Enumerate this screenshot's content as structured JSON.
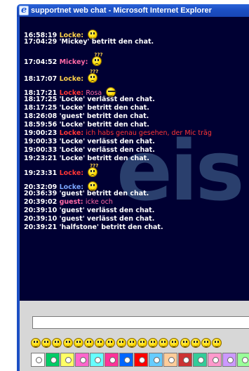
{
  "window": {
    "title": "supportnet web chat - Microsoft Internet Explorer"
  },
  "chat": {
    "watermark": "eis",
    "lines": [
      {
        "time": "16:58:19",
        "nick": "Locke:",
        "text": "",
        "smiley": "happy"
      },
      {
        "time": "17:04:29",
        "nick": "",
        "text": "'Mickey' betritt den chat."
      },
      {
        "time": "17:04:52",
        "nick": "Mickey:",
        "text": "",
        "smiley": "think"
      },
      {
        "time": "18:17:07",
        "nick": "Locke:",
        "text": "",
        "smiley": "think"
      },
      {
        "time": "18:17:21",
        "nick": "Locke:",
        "text": "Rosa",
        "smiley": "cool"
      },
      {
        "time": "18:17:25",
        "nick": "",
        "text": "'Locke' verlässt den chat."
      },
      {
        "time": "18:17:25",
        "nick": "",
        "text": "'Locke' betritt den chat."
      },
      {
        "time": "18:26:08",
        "nick": "",
        "text": "'guest' betritt den chat."
      },
      {
        "time": "18:59:56",
        "nick": "",
        "text": "'Locke' betritt den chat."
      },
      {
        "time": "19:00:23",
        "nick": "Locke:",
        "text": "ich habs genau gesehen, der Mic träg"
      },
      {
        "time": "19:00:33",
        "nick": "",
        "text": "'Locke' verlässt den chat."
      },
      {
        "time": "19:00:33",
        "nick": "",
        "text": "'Locke' verlässt den chat."
      },
      {
        "time": "19:23:21",
        "nick": "",
        "text": "'Locke' betritt den chat."
      },
      {
        "time": "19:23:31",
        "nick": "Locke:",
        "text": "",
        "smiley": "think"
      },
      {
        "time": "20:32:09",
        "nick": "Locke:",
        "text": "",
        "smiley": "happy"
      },
      {
        "time": "20:36:39",
        "nick": "",
        "text": "'guest' betritt den chat."
      },
      {
        "time": "20:39:02",
        "nick": "guest:",
        "text": "icke och"
      },
      {
        "time": "20:39:10",
        "nick": "",
        "text": "'guest' verlässt den chat."
      },
      {
        "time": "20:39:10",
        "nick": "",
        "text": "'guest' verlässt den chat."
      },
      {
        "time": "20:39:21",
        "nick": "",
        "text": "'halfstone' betritt den chat."
      }
    ]
  },
  "composer": {
    "input_value": "",
    "emoji_qmark": "???",
    "emojis": [
      "smile",
      "grin",
      "laugh",
      "wink",
      "tongue",
      "think",
      "surprised",
      "angry",
      "cool",
      "sad",
      "cry",
      "blush",
      "confused",
      "sleepy",
      "devil",
      "kiss",
      "nerd",
      "shock"
    ],
    "swatch_colors": [
      "#ffffff",
      "#00cc66",
      "#ffff66",
      "#ff66cc",
      "#66ffff",
      "#ff3399",
      "#0066ff",
      "#ff0000",
      "#66ccff",
      "#ffcc99",
      "#cc3333",
      "#33cc99",
      "#ff99cc",
      "#cc99ff",
      "#99ff99"
    ]
  }
}
